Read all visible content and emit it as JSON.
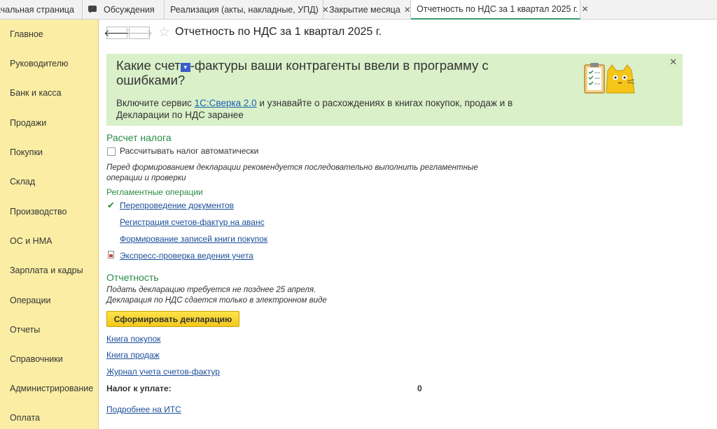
{
  "tabs": [
    {
      "label": "ачальная страница"
    },
    {
      "label": "Обсуждения"
    },
    {
      "label": "Реализация (акты, накладные, УПД)"
    },
    {
      "label": "Закрытие месяца"
    },
    {
      "label": "Отчетность по НДС за 1 квартал 2025 г."
    }
  ],
  "sidebar": {
    "items": [
      {
        "label": "Главное"
      },
      {
        "label": "Руководителю"
      },
      {
        "label": "Банк и касса"
      },
      {
        "label": "Продажи"
      },
      {
        "label": "Покупки"
      },
      {
        "label": "Склад"
      },
      {
        "label": "Производство"
      },
      {
        "label": "ОС и НМА"
      },
      {
        "label": "Зарплата и кадры"
      },
      {
        "label": "Операции"
      },
      {
        "label": "Отчеты"
      },
      {
        "label": "Справочники"
      },
      {
        "label": "Администрирование"
      },
      {
        "label": "Оплата"
      }
    ]
  },
  "header": {
    "title": "Отчетность по НДС за 1 квартал 2025 г."
  },
  "banner": {
    "heading_part1": "Какие счет",
    "heading_part2": "-фактуры ваши контрагенты ввели в программу с ошибками?",
    "text_before": "Включите сервис ",
    "link": "1С:Сверка 2.0",
    "text_after": " и узнавайте о расхождениях в книгах покупок, продаж и в Декларации по НДС заранее"
  },
  "tax_calc": {
    "title": "Расчет налога",
    "auto_checkbox_label": "Рассчитывать налог автоматически",
    "auto_checked": false,
    "note": "Перед формированием декларации рекомендуется последовательно выполнить регламентные операции и проверки"
  },
  "operations": {
    "title": "Регламентные операции",
    "items": [
      {
        "label": "Перепроведение документов",
        "done": true
      },
      {
        "label": "Регистрация счетов-фактур на аванс"
      },
      {
        "label": "Формирование записей книги покупок"
      },
      {
        "label": "Экспресс-проверка ведения учета"
      }
    ]
  },
  "reporting": {
    "title": "Отчетность",
    "note1": "Подать декларацию требуется не позднее 25 апреля.",
    "note2": "Декларация по НДС сдается только в электронном виде",
    "generate_button": "Сформировать декларацию",
    "links": [
      {
        "label": "Книга покупок"
      },
      {
        "label": "Книга продаж"
      },
      {
        "label": "Журнал учета счетов-фактур"
      }
    ],
    "tax_due_label": "Налог к уплате:",
    "tax_due_value": "0",
    "more_link": "Подробнее на ИТС"
  },
  "colors": {
    "sidebar_bg": "#fbeea4",
    "banner_bg": "#d9f0c9",
    "section_green": "#2a8a45",
    "button_yellow": "#f4c81a"
  }
}
